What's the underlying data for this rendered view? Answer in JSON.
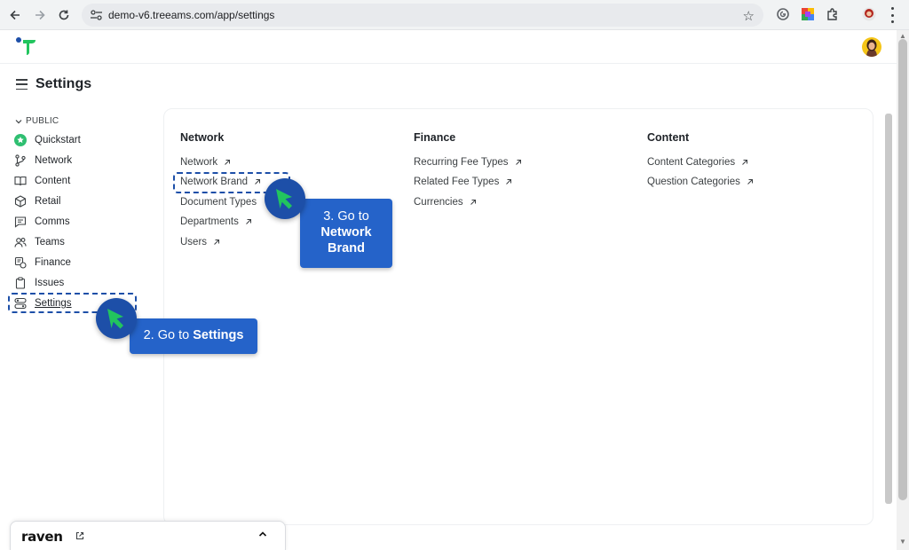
{
  "browser": {
    "url": "demo-v6.treeams.com/app/settings"
  },
  "page": {
    "title": "Settings"
  },
  "sidebar": {
    "section": "PUBLIC",
    "items": [
      {
        "label": "Quickstart",
        "icon": "quickstart-star-icon"
      },
      {
        "label": "Network",
        "icon": "network-branch-icon"
      },
      {
        "label": "Content",
        "icon": "book-icon"
      },
      {
        "label": "Retail",
        "icon": "box-icon"
      },
      {
        "label": "Comms",
        "icon": "chat-icon"
      },
      {
        "label": "Teams",
        "icon": "users-icon"
      },
      {
        "label": "Finance",
        "icon": "finance-icon"
      },
      {
        "label": "Issues",
        "icon": "clipboard-icon"
      },
      {
        "label": "Settings",
        "icon": "settings-toggle-icon",
        "active": true
      }
    ]
  },
  "columns": [
    {
      "title": "Network",
      "links": [
        "Network",
        "Network Brand",
        "Document Types",
        "Departments",
        "Users"
      ]
    },
    {
      "title": "Finance",
      "links": [
        "Recurring Fee Types",
        "Related Fee Types",
        "Currencies"
      ]
    },
    {
      "title": "Content",
      "links": [
        "Content Categories",
        "Question Categories"
      ]
    }
  ],
  "annotations": {
    "step2": {
      "prefix": "2. Go to ",
      "bold": "Settings"
    },
    "step3": {
      "line1": "3. Go to",
      "line2": "Network",
      "line3": "Brand"
    }
  },
  "raven": {
    "label": "raven"
  },
  "colors": {
    "accent": "#1d4fa8",
    "tooltip": "#2563c9",
    "pointer_arrow": "#22c55e",
    "quickstart_green": "#2fbf71",
    "avatar_bg": "#f5c518"
  }
}
